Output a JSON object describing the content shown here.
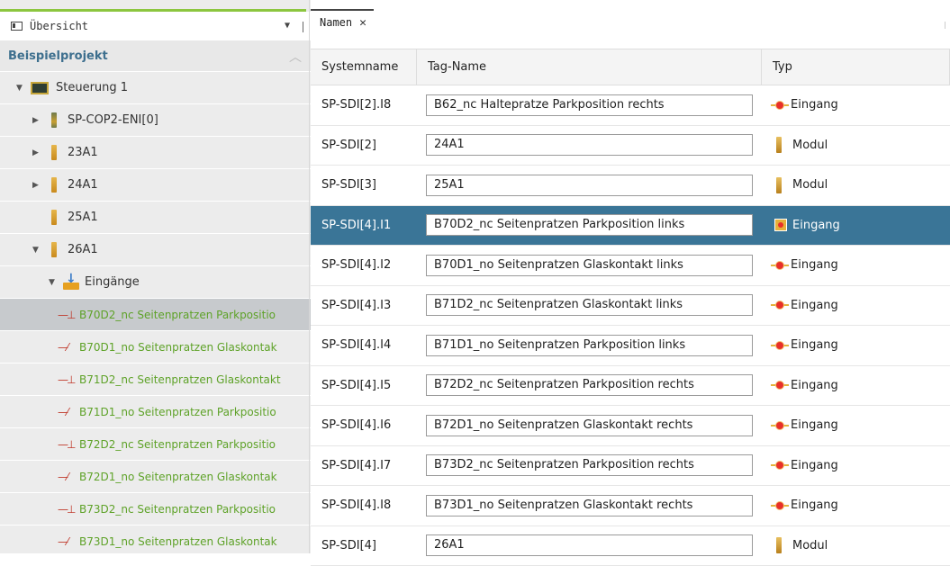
{
  "left": {
    "header_title": "Übersicht",
    "project": "Beispielprojekt",
    "tree": [
      {
        "label": "Steuerung 1",
        "kind": "controller",
        "level": 0,
        "expander": "open"
      },
      {
        "label": "SP-COP2-ENI[0]",
        "kind": "module-dark",
        "level": 1,
        "expander": "closed"
      },
      {
        "label": "23A1",
        "kind": "module",
        "level": 1,
        "expander": "closed"
      },
      {
        "label": "24A1",
        "kind": "module",
        "level": 1,
        "expander": "closed"
      },
      {
        "label": "25A1",
        "kind": "module",
        "level": 1,
        "expander": "none"
      },
      {
        "label": "26A1",
        "kind": "module",
        "level": 1,
        "expander": "open"
      },
      {
        "label": "Eingänge",
        "kind": "inputs",
        "level": 2,
        "expander": "open"
      }
    ],
    "signals": [
      {
        "label": "B70D2_nc Seitenpratzen Parkpositio",
        "contact": "nc",
        "selected": true
      },
      {
        "label": "B70D1_no Seitenpratzen Glaskontak",
        "contact": "no",
        "selected": false
      },
      {
        "label": "B71D2_nc Seitenpratzen Glaskontakt",
        "contact": "nc",
        "selected": false
      },
      {
        "label": "B71D1_no Seitenpratzen Parkpositio",
        "contact": "no",
        "selected": false
      },
      {
        "label": "B72D2_nc Seitenpratzen Parkpositio",
        "contact": "nc",
        "selected": false
      },
      {
        "label": "B72D1_no Seitenpratzen Glaskontak",
        "contact": "no",
        "selected": false
      },
      {
        "label": "B73D2_nc Seitenpratzen Parkpositio",
        "contact": "nc",
        "selected": false
      },
      {
        "label": "B73D1_no Seitenpratzen Glaskontak",
        "contact": "no",
        "selected": false
      }
    ]
  },
  "right": {
    "tab_label": "Namen",
    "columns": [
      "Systemname",
      "Tag-Name",
      "Typ"
    ],
    "rows": [
      {
        "system": "SP-SDI[2].I8",
        "tag": "B62_nc Haltepratze Parkposition rechts",
        "typ": "Eingang",
        "icon": "input",
        "selected": false
      },
      {
        "system": "SP-SDI[2]",
        "tag": "24A1",
        "typ": "Modul",
        "icon": "module",
        "selected": false
      },
      {
        "system": "SP-SDI[3]",
        "tag": "25A1",
        "typ": "Modul",
        "icon": "module",
        "selected": false
      },
      {
        "system": "SP-SDI[4].I1",
        "tag": "B70D2_nc Seitenpratzen Parkposition links",
        "typ": "Eingang",
        "icon": "input",
        "selected": true
      },
      {
        "system": "SP-SDI[4].I2",
        "tag": "B70D1_no Seitenpratzen Glaskontakt links",
        "typ": "Eingang",
        "icon": "input",
        "selected": false
      },
      {
        "system": "SP-SDI[4].I3",
        "tag": "B71D2_nc Seitenpratzen Glaskontakt links",
        "typ": "Eingang",
        "icon": "input",
        "selected": false
      },
      {
        "system": "SP-SDI[4].I4",
        "tag": "B71D1_no Seitenpratzen Parkposition links",
        "typ": "Eingang",
        "icon": "input",
        "selected": false
      },
      {
        "system": "SP-SDI[4].I5",
        "tag": "B72D2_nc Seitenpratzen Parkposition rechts",
        "typ": "Eingang",
        "icon": "input",
        "selected": false
      },
      {
        "system": "SP-SDI[4].I6",
        "tag": "B72D1_no Seitenpratzen Glaskontakt rechts",
        "typ": "Eingang",
        "icon": "input",
        "selected": false
      },
      {
        "system": "SP-SDI[4].I7",
        "tag": "B73D2_nc Seitenpratzen Parkposition rechts",
        "typ": "Eingang",
        "icon": "input",
        "selected": false
      },
      {
        "system": "SP-SDI[4].I8",
        "tag": "B73D1_no Seitenpratzen Glaskontakt rechts",
        "typ": "Eingang",
        "icon": "input",
        "selected": false
      },
      {
        "system": "SP-SDI[4]",
        "tag": "26A1",
        "typ": "Modul",
        "icon": "module",
        "selected": false
      }
    ]
  }
}
